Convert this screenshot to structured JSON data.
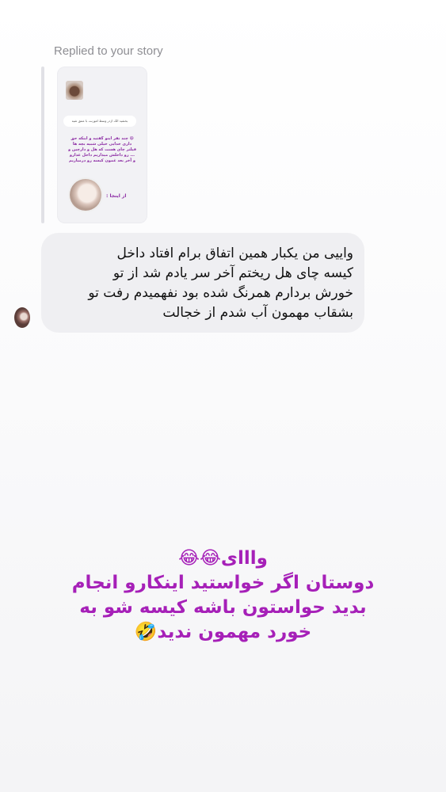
{
  "replied_label": "Replied to your story",
  "story": {
    "reply_text": "بخشید الک اژدر وسط اغوزنت با عنتق شیه",
    "text": "😄 چند نفر اینو گفتید و اینکه حق داری خدایی خیلی شبیه بچه ها فیلتر چای هست که هل و دارچین و ... رو داخلش میذاریم داخل غذارو و آخر بعد غمون کیسه رو درمیاریم",
    "from_label": "از اینجا :"
  },
  "message": {
    "lines": [
      "واییی من یکبار همین اتفاق برام افتاد داخل",
      "کیسه چای هل  ریختم آخر سر یادم شد از تو",
      "خورش بردارم همرنگ شده بود نفهمیدم رفت تو",
      "بشقاب مهمون آب شدم از خجالت"
    ]
  },
  "overlay": {
    "lines": [
      "وااای😂😂",
      "دوستان اگر خواستید اینکارو انجام",
      "بدید حواستون باشه کیسه شو به",
      "خورد مهمون ندید🤣"
    ],
    "color": "#a620b8"
  }
}
